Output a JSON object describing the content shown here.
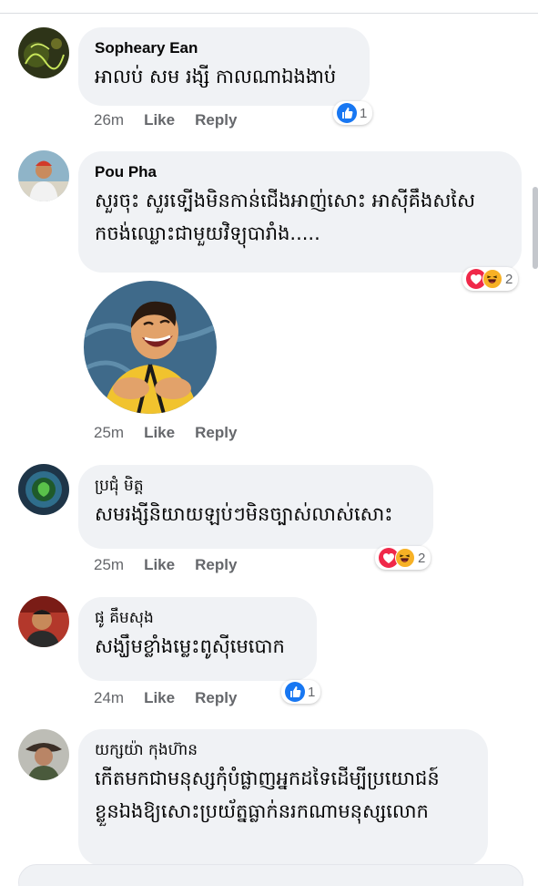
{
  "comments": [
    {
      "name": "Sopheary Ean",
      "text_lines": [
        "អាលប់ សម រង្សី កាលណាឯងងាប់"
      ],
      "time": "26m",
      "like_label": "Like",
      "reply_label": "Reply",
      "reactions": {
        "types": [
          "like"
        ],
        "count": "1"
      }
    },
    {
      "name": "Pou Pha",
      "text_lines": [
        "សួរចុះ សួរទ្បើងមិនកាន់ជើងអាញ់សោះ អាសុីគឹងសសៃ",
        "កចង់ឈ្លោះជាមួយវិទ្យុបារាំង....."
      ],
      "time": "25m",
      "like_label": "Like",
      "reply_label": "Reply",
      "reactions": {
        "types": [
          "love",
          "haha"
        ],
        "count": "2"
      }
    },
    {
      "name": "ប្រជុំ មិត្ត",
      "text_lines": [
        "សមរង្សីនិយាយឡប់ៗមិនច្បាស់លាស់សោះ"
      ],
      "time": "25m",
      "like_label": "Like",
      "reply_label": "Reply",
      "reactions": {
        "types": [
          "love",
          "haha"
        ],
        "count": "2"
      }
    },
    {
      "name": "ផូ គឹមសុង",
      "text_lines": [
        "សង្ឃឹមខ្លាំងម្លេះពូស៊ីមេបោក"
      ],
      "time": "24m",
      "like_label": "Like",
      "reply_label": "Reply",
      "reactions": {
        "types": [
          "like"
        ],
        "count": "1"
      }
    },
    {
      "name": "យក្សយ៉ា កុងហ៊ាន",
      "text_lines": [
        "កើតមកជាមនុស្សកុំបំផ្លាញអ្នកដទៃដើម្បីប្រយោជន៍",
        "ខ្លួនឯងឱ្យសោះប្រយ័ត្នធ្លាក់នរកណាមនុស្សលោក"
      ]
    }
  ],
  "colors": {
    "bubble_bg": "#f0f2f5",
    "meta_text": "#65676b",
    "like_blue": "#1877f2",
    "love_red": "#f02849",
    "haha_yellow": "#f7b125"
  },
  "icons": {
    "sticker": "laughing-man-sticker",
    "like": "thumbs-up-icon",
    "love": "heart-icon",
    "haha": "laughing-face-icon"
  }
}
